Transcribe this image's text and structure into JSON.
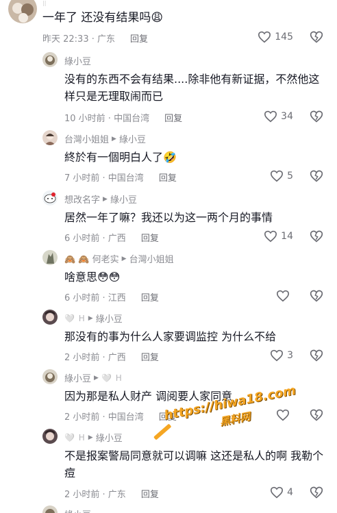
{
  "top_sliver": "||",
  "comments": [
    {
      "name": "",
      "text": "一年了 还没有结果吗😩",
      "time": "昨天 22:33 · 广东",
      "reply": "回复",
      "likes": "145",
      "avatar_color": "#c9b8a6"
    },
    {
      "name": "綠小豆",
      "text": "没有的东西不会有结果....除非他有新证据，不然他这样只是无理取闹而已",
      "time": "10 小时前 · 中国台湾",
      "reply": "回复",
      "likes": "34",
      "avatar_color": "#a99f8e"
    },
    {
      "name": "台灣小姐姐",
      "reply_to": "綠小豆",
      "text": "終於有一個明白人了🤣",
      "time": "7 小时前 · 中国台湾",
      "reply": "回复",
      "likes": "5",
      "avatar_color": "#d4bcb0"
    },
    {
      "name": "想改名字",
      "reply_to": "綠小豆",
      "text": "居然一年了嘛？我还以为这一两个月的事情",
      "time": "6 小时前 · 广西",
      "reply": "回复",
      "likes": "14",
      "avatar_color": "#e9eef2"
    },
    {
      "name": "🙈 🙈 何老实",
      "reply_to": "台灣小姐姐",
      "text": "啥意思😳😳",
      "time": "6 小时前 · 江西",
      "reply": "回复",
      "likes": "",
      "avatar_color": "#9da08e"
    },
    {
      "name": "🤍 ᕼ",
      "reply_to": "綠小豆",
      "text": "那没有的事为什么人家要调监控 为什么不给",
      "time": "2 小时前 · 广西",
      "reply": "回复",
      "likes": "3",
      "avatar_color": "#6b5a5e"
    },
    {
      "name": "綠小豆",
      "reply_to": "🤍 ᕼ",
      "text": "因为那是私人财产 调阅要人家同意",
      "time": "2 小时前 · 中国台湾",
      "reply": "回复",
      "likes": "",
      "avatar_color": "#a99f8e"
    },
    {
      "name": "🤍 ᕼ",
      "reply_to": "綠小豆",
      "text": "不是报案警局同意就可以调嘛 这还是私人的啊 我勒个痘",
      "time": "2 小时前 · 广东",
      "reply": "回复",
      "likes": "4",
      "avatar_color": "#6b5a5e"
    },
    {
      "name": "綠小豆",
      "reply_to": "",
      "text": "",
      "time": "",
      "reply": "",
      "likes": "",
      "avatar_color": "#a99f8e"
    }
  ],
  "watermark": {
    "url": "https://hiwa18.com",
    "cn": "黑料网"
  },
  "colors": {
    "text": "#161823",
    "meta": "#8a8b91",
    "watermark": "#f5a623"
  },
  "icons": {
    "like": "heart-outline-icon",
    "dislike": "broken-heart-icon",
    "reply_arrow": "triangle-right-icon"
  }
}
